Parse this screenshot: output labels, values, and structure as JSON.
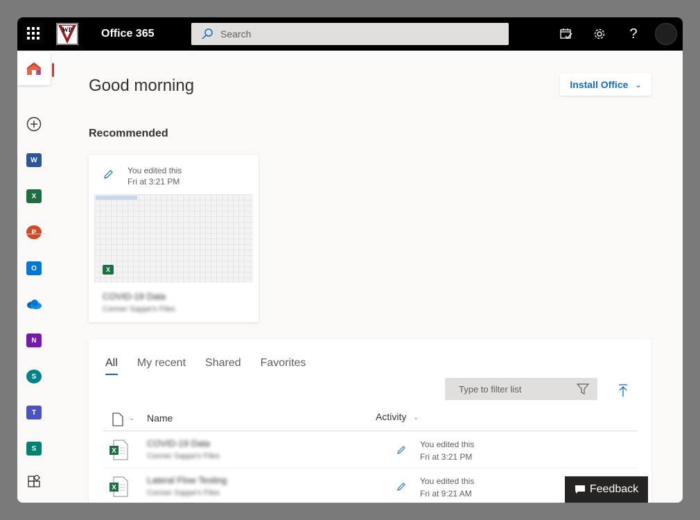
{
  "topbar": {
    "brand": "Office 365",
    "search_placeholder": "Search"
  },
  "main": {
    "greeting": "Good morning",
    "install_label": "Install Office",
    "recommended_title": "Recommended",
    "recommended_card": {
      "activity_line1": "You edited this",
      "activity_line2": "Fri at 3:21 PM",
      "name": "COVID-19 Data",
      "location": "Conner Sappe's Files"
    }
  },
  "files": {
    "tabs": [
      "All",
      "My recent",
      "Shared",
      "Favorites"
    ],
    "filter_placeholder": "Type to filter list",
    "col_name": "Name",
    "col_activity": "Activity",
    "rows": [
      {
        "name": "COVID-19 Data",
        "location": "Conner Sappe's Files",
        "activity_line1": "You edited this",
        "activity_line2": "Fri at 3:21 PM"
      },
      {
        "name": "Lateral Flow Testing",
        "location": "Conner Sappe's Files",
        "activity_line1": "You edited this",
        "activity_line2": "Fri at 9:21 AM"
      }
    ]
  },
  "feedback_label": "Feedback",
  "rail": {
    "items": [
      "home-icon",
      "create-icon",
      "word-icon",
      "excel-icon",
      "powerpoint-icon",
      "outlook-icon",
      "onedrive-icon",
      "onenote-icon",
      "sharepoint-icon",
      "teams-icon",
      "sway-icon",
      "all-apps-icon"
    ]
  },
  "colors": {
    "accent": "#0f6cbd",
    "home_indicator": "#d13438",
    "excel": "#1d6f42"
  }
}
